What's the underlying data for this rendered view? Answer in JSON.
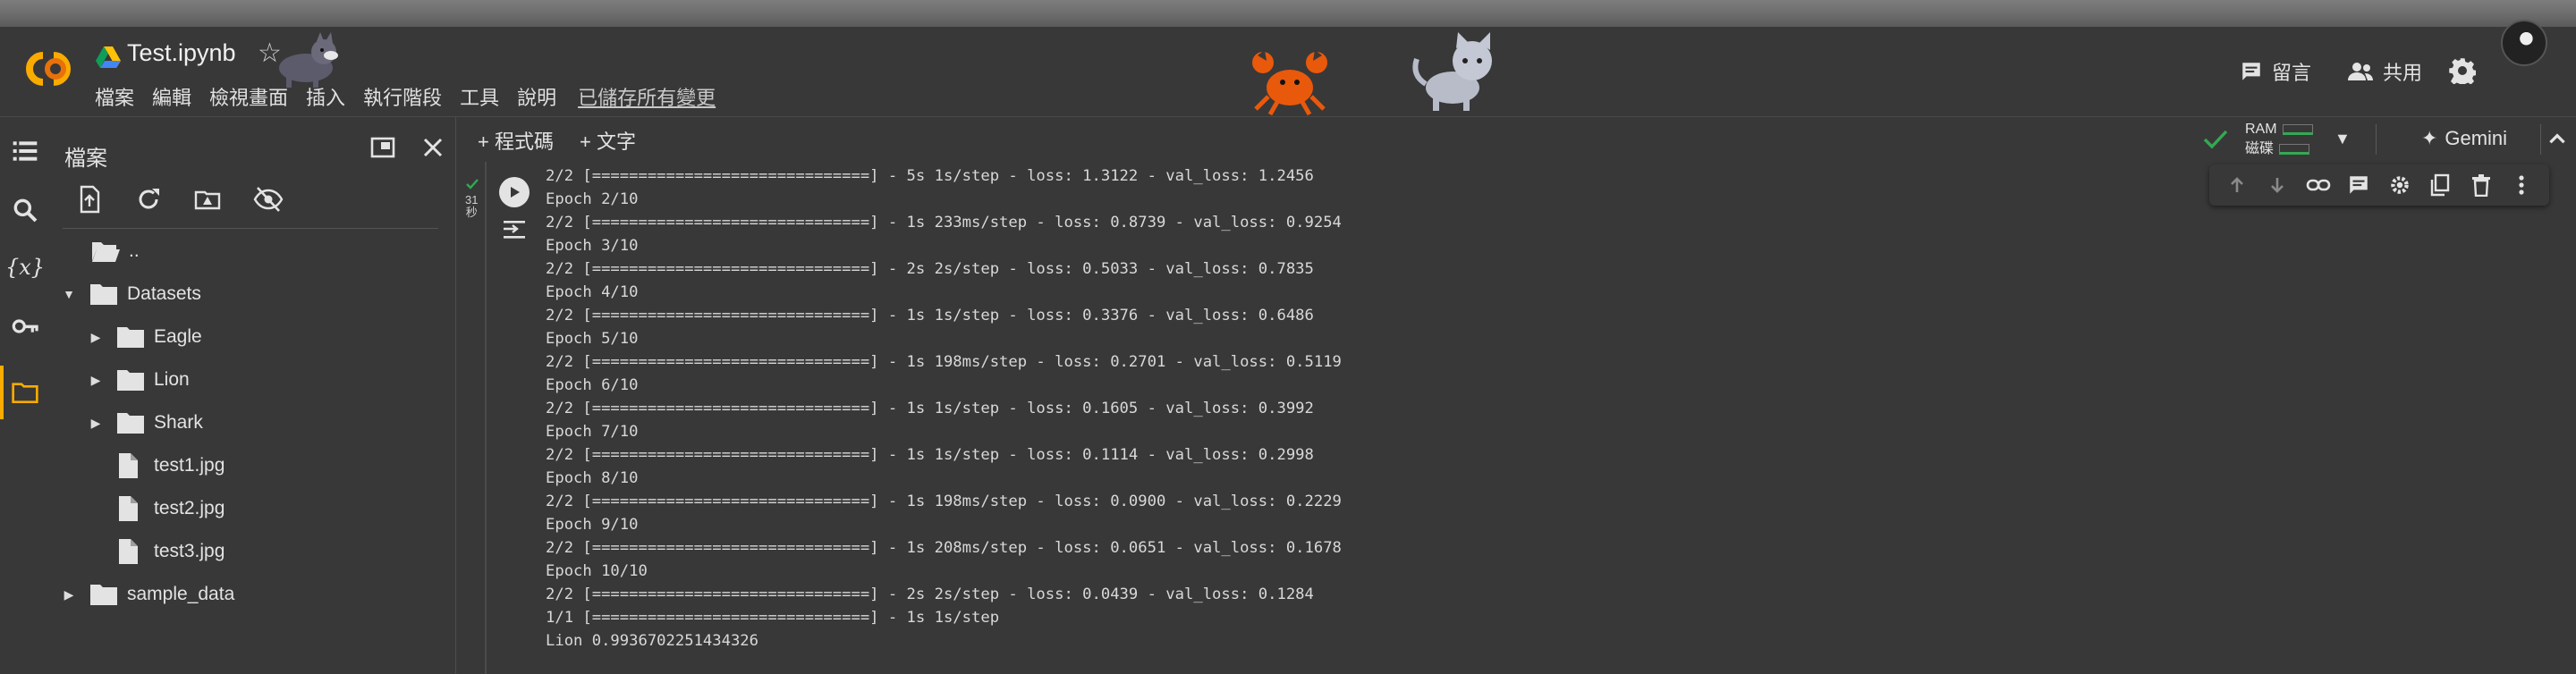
{
  "notebook": {
    "title": "Test.ipynb",
    "menu": [
      "檔案",
      "編輯",
      "檢視畫面",
      "插入",
      "執行階段",
      "工具",
      "說明"
    ],
    "saved_status": "已儲存所有變更"
  },
  "header_right": {
    "comment_label": "留言",
    "share_label": "共用"
  },
  "sidebar": {
    "title": "檔案",
    "tree": [
      {
        "label": "..",
        "type": "folder-open"
      },
      {
        "label": "Datasets",
        "type": "folder",
        "expanded": true
      },
      {
        "label": "Eagle",
        "type": "folder"
      },
      {
        "label": "Lion",
        "type": "folder"
      },
      {
        "label": "Shark",
        "type": "folder"
      },
      {
        "label": "test1.jpg",
        "type": "file"
      },
      {
        "label": "test2.jpg",
        "type": "file"
      },
      {
        "label": "test3.jpg",
        "type": "file"
      },
      {
        "label": "sample_data",
        "type": "folder"
      }
    ]
  },
  "toolbar": {
    "add_code": "+ 程式碼",
    "add_text": "+ 文字",
    "ram_label": "RAM",
    "disk_label": "磁碟",
    "gemini_label": "Gemini"
  },
  "cell": {
    "exec_time": "31",
    "exec_unit": "秒",
    "output_lines": [
      "2/2 [==============================] - 5s 1s/step - loss: 1.3122 - val_loss: 1.2456",
      "Epoch 2/10",
      "2/2 [==============================] - 1s 233ms/step - loss: 0.8739 - val_loss: 0.9254",
      "Epoch 3/10",
      "2/2 [==============================] - 2s 2s/step - loss: 0.5033 - val_loss: 0.7835",
      "Epoch 4/10",
      "2/2 [==============================] - 1s 1s/step - loss: 0.3376 - val_loss: 0.6486",
      "Epoch 5/10",
      "2/2 [==============================] - 1s 198ms/step - loss: 0.2701 - val_loss: 0.5119",
      "Epoch 6/10",
      "2/2 [==============================] - 1s 1s/step - loss: 0.1605 - val_loss: 0.3992",
      "Epoch 7/10",
      "2/2 [==============================] - 1s 1s/step - loss: 0.1114 - val_loss: 0.2998",
      "Epoch 8/10",
      "2/2 [==============================] - 1s 198ms/step - loss: 0.0900 - val_loss: 0.2229",
      "Epoch 9/10",
      "2/2 [==============================] - 1s 208ms/step - loss: 0.0651 - val_loss: 0.1678",
      "Epoch 10/10",
      "2/2 [==============================] - 2s 2s/step - loss: 0.0439 - val_loss: 0.1284",
      "1/1 [==============================] - 1s 1s/step",
      "Lion 0.9936702251434326"
    ]
  },
  "colors": {
    "background": "#383838",
    "accent": "#f9ab00",
    "success": "#34a853",
    "text": "#e3e3e3"
  },
  "icons": [
    "colab-logo",
    "drive-icon",
    "star-icon",
    "comment-icon",
    "share-icon",
    "gear-icon",
    "list-icon",
    "search-icon",
    "variables-icon",
    "key-icon",
    "folder-icon",
    "upload-icon",
    "refresh-icon",
    "drive-mount-icon",
    "hide-icon",
    "check-icon",
    "arrow-up-icon",
    "arrow-down-icon",
    "link-icon",
    "copy-icon",
    "delete-icon",
    "more-icon"
  ]
}
